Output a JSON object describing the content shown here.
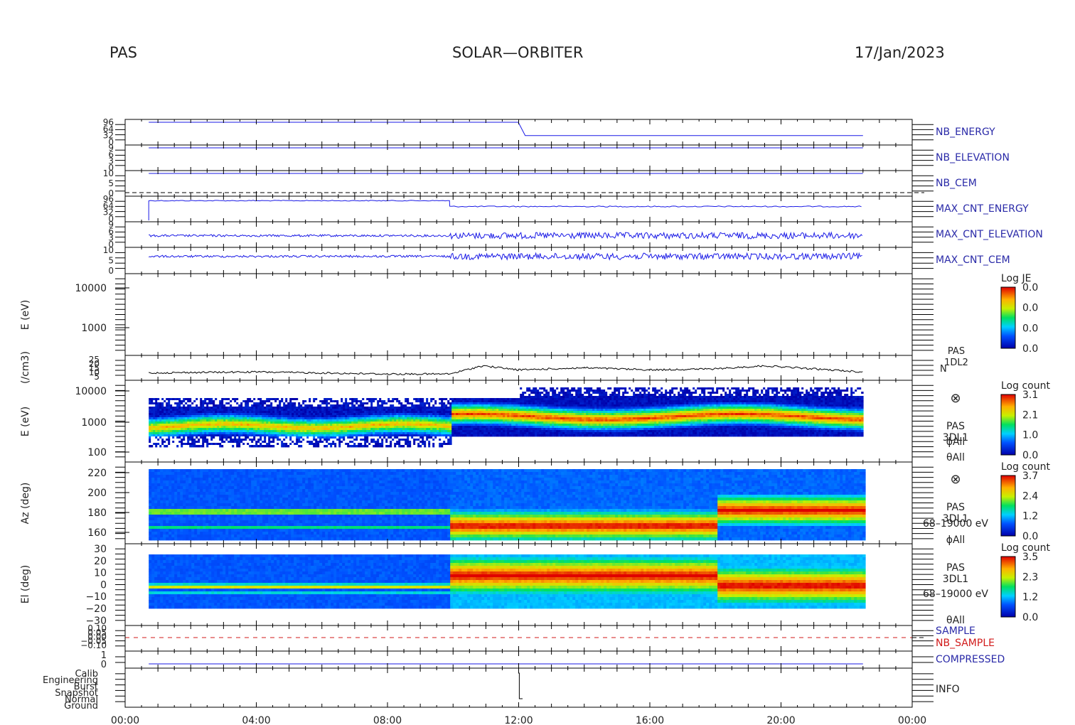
{
  "header": {
    "instrument": "PAS",
    "mission": "SOLAR—ORBITER",
    "date": "17/Jan/2023"
  },
  "colors": {
    "housekeeping_label": "#2a2aa8",
    "nb_sample": "#d11a1a",
    "trace_blue": "#1a1ae6",
    "trace_black": "#000000"
  },
  "chart_data": {
    "type": "heatmap",
    "time_axis": {
      "range_hours": [
        0,
        24
      ],
      "tick_labels": [
        "00:00",
        "04:00",
        "08:00",
        "12:00",
        "16:00",
        "20:00",
        "00:00"
      ],
      "tick_hours": [
        0,
        4,
        8,
        12,
        16,
        20,
        24
      ],
      "data_start_hour": 0.72,
      "data_end_hour": 22.5,
      "transition_hour": 9.9
    },
    "panels": [
      {
        "id": "nb_energy",
        "side_label": "NB_ENERGY",
        "type": "line",
        "tick_labels": [
          "96",
          "64",
          "32",
          "0"
        ],
        "series": [
          {
            "name": "NB_ENERGY",
            "x": [
              0.72,
              11.99,
              12.2,
              22.5
            ],
            "y": [
              96,
              96,
              32,
              32
            ]
          }
        ]
      },
      {
        "id": "nb_elevation",
        "side_label": "NB_ELEVATION",
        "type": "line",
        "tick_labels": [
          "9",
          "6",
          "3",
          "0"
        ],
        "series": [
          {
            "name": "NB_ELEVATION",
            "x": [
              0.72,
              22.5
            ],
            "y": [
              9,
              9
            ]
          }
        ]
      },
      {
        "id": "nb_cem",
        "side_label": "NB_CEM",
        "type": "line",
        "tick_labels": [
          "10",
          "5",
          "0"
        ],
        "series": [
          {
            "name": "NB_CEM",
            "x": [
              0.72,
              22.5
            ],
            "y": [
              10,
              10
            ]
          }
        ]
      },
      {
        "id": "max_cnt_energy",
        "side_label": "MAX_CNT_ENERGY",
        "type": "line",
        "tick_labels": [
          "96",
          "64",
          "32",
          "0"
        ],
        "series": [
          {
            "name": "MAX_CNT_ENERGY",
            "x": [
              0.72,
              9.9,
              22.5
            ],
            "y": [
              88,
              88,
              60
            ]
          }
        ]
      },
      {
        "id": "max_cnt_elevation",
        "side_label": "MAX_CNT_ELEVATION",
        "type": "line",
        "tick_labels": [
          "9",
          "6",
          "3",
          "0"
        ],
        "series": [
          {
            "name": "MAX_CNT_ELEVATION",
            "x": [
              0.72,
              22.5
            ],
            "y": [
              4,
              4
            ]
          }
        ]
      },
      {
        "id": "max_cnt_cem",
        "side_label": "MAX_CNT_CEM",
        "type": "line",
        "tick_labels": [
          "10",
          "5",
          "0"
        ],
        "series": [
          {
            "name": "MAX_CNT_CEM",
            "x": [
              0.72,
              22.5
            ],
            "y": [
              7,
              7
            ]
          }
        ]
      }
    ],
    "je_spectrogram": {
      "ylabel": "E (eV)",
      "y_ticks": [
        "10000",
        "1000"
      ],
      "colorbar_title": "Log JE",
      "colorbar_labels": [
        "0.0",
        "0.0",
        "0.0",
        "0.0"
      ]
    },
    "density": {
      "ylabel": "(/cm3)",
      "y_ticks": [
        "25",
        "20",
        "15",
        "10",
        "5"
      ],
      "ylim": [
        5,
        25
      ],
      "side_labels": [
        "PAS",
        "1DL2",
        "N"
      ],
      "x": [
        0.72,
        2,
        4,
        6,
        8,
        9.9,
        10.9,
        12,
        14,
        16,
        18,
        19.5,
        22.5
      ],
      "y": [
        10,
        10.5,
        11,
        10,
        9,
        9,
        17,
        13,
        15,
        13,
        14,
        17,
        11
      ]
    },
    "energy_spectrogram": {
      "ylabel": "E (eV)",
      "y_ticks": [
        "10000",
        "1000",
        "100"
      ],
      "colorbar_title": "Log count",
      "colorbar_labels": [
        "3.1",
        "2.1",
        "1.0",
        "0.0"
      ],
      "side_labels": [
        "PAS",
        "3DL1",
        "ϕAll",
        "θAll"
      ],
      "peak_energy_eV": [
        700,
        1600
      ]
    },
    "azimuth_spectrogram": {
      "ylabel": "Az (deg)",
      "y_ticks": [
        "220",
        "200",
        "180",
        "160"
      ],
      "ylim": [
        155,
        225
      ],
      "colorbar_title": "Log count",
      "colorbar_labels": [
        "3.7",
        "2.4",
        "1.2",
        "0.0"
      ],
      "side_labels": [
        "PAS",
        "3DL1",
        "68–19000 eV",
        "ϕAll"
      ]
    },
    "elevation_spectrogram": {
      "ylabel": "El (deg)",
      "y_ticks": [
        "30",
        "20",
        "10",
        "0",
        "−10",
        "−20",
        "−30"
      ],
      "ylim": [
        -30,
        30
      ],
      "colorbar_title": "Log count",
      "colorbar_labels": [
        "3.5",
        "2.3",
        "1.2",
        "0.0"
      ],
      "side_labels": [
        "PAS",
        "3DL1",
        "68–19000 eV",
        "θAll"
      ]
    },
    "sample": {
      "side_labels": [
        "SAMPLE",
        "NB_SAMPLE"
      ],
      "y_ticks": [
        "0.10",
        "0.05",
        "0.00",
        "−0.05",
        "−0.10"
      ]
    },
    "compressed": {
      "side_label": "COMPRESSED",
      "y_ticks": [
        "1",
        "0"
      ],
      "x": [
        0.72,
        22.5
      ],
      "y": [
        0,
        0
      ]
    },
    "info": {
      "side_label": "INFO",
      "y_ticks": [
        "Calib",
        "Engineering",
        "Burst",
        "Snapshot",
        "Normal",
        "Ground"
      ],
      "x": [
        11.99,
        12.02,
        12.02,
        12.12,
        12.12
      ],
      "y": [
        "Calib",
        "Calib",
        "Normal",
        "Normal",
        "Normal"
      ]
    }
  }
}
